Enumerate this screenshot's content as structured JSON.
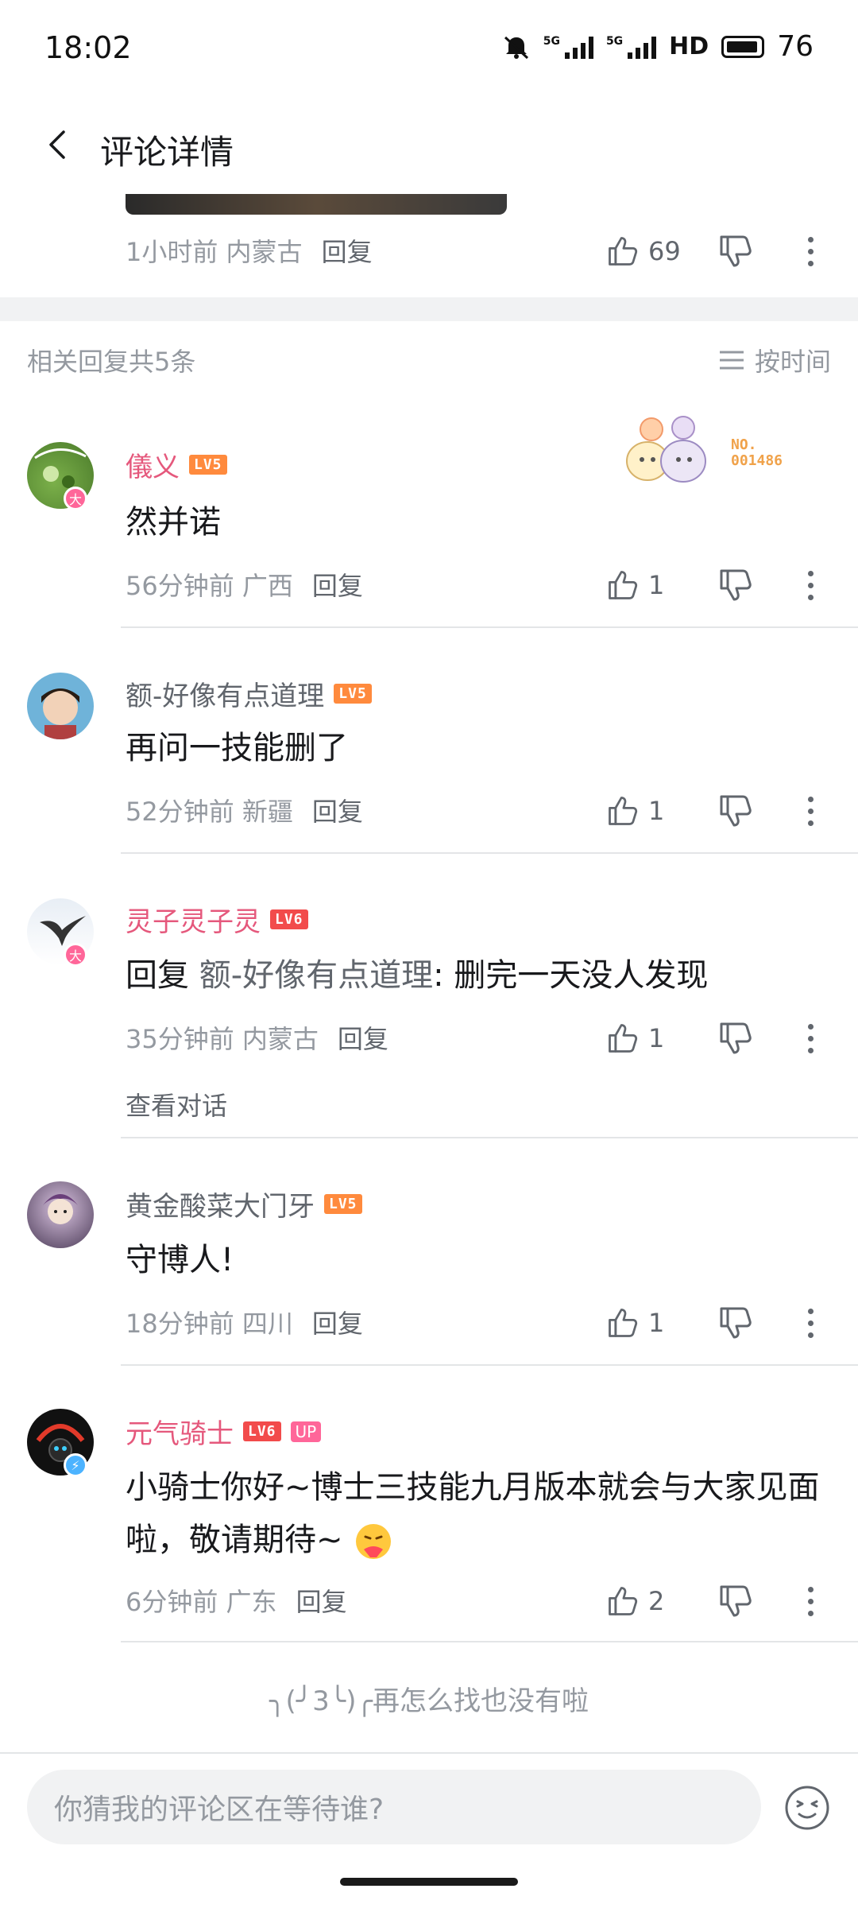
{
  "status": {
    "time": "18:02",
    "sig1": "5G",
    "sig2": "5G",
    "hd": "HD",
    "battery": "76"
  },
  "header": {
    "title": "评论详情"
  },
  "parent": {
    "time": "1小时前",
    "location": "内蒙古",
    "reply": "回复",
    "likes": "69"
  },
  "section": {
    "count_label": "相关回复共5条",
    "sort_label": "按时间"
  },
  "fan_badge": {
    "line1": "NO.",
    "line2": "001486"
  },
  "comments": [
    {
      "user": "儀义",
      "level": "LV5",
      "text": "然并诺",
      "time": "56分钟前",
      "location": "广西",
      "reply": "回复",
      "likes": "1",
      "badge": "大"
    },
    {
      "user": "额-好像有点道理",
      "level": "LV5",
      "text": "再问一技能删了",
      "time": "52分钟前",
      "location": "新疆",
      "reply": "回复",
      "likes": "1"
    },
    {
      "user": "灵子灵子灵",
      "level": "LV6",
      "reply_prefix": "回复",
      "mention": "额-好像有点道理",
      "text": ": 删完一天没人发现",
      "time": "35分钟前",
      "location": "内蒙古",
      "reply": "回复",
      "likes": "1",
      "view_conv": "查看对话",
      "badge": "大"
    },
    {
      "user": "黄金酸菜大门牙",
      "level": "LV5",
      "text": "守博人!",
      "time": "18分钟前",
      "location": "四川",
      "reply": "回复",
      "likes": "1"
    },
    {
      "user": "元气骑士",
      "level": "LV6",
      "up": "UP",
      "text": "小骑士你好~博士三技能九月版本就会与大家见面啦，敬请期待~",
      "time": "6分钟前",
      "location": "广东",
      "reply": "回复",
      "likes": "2"
    }
  ],
  "end_text": "╮(╯3╰)╭再怎么找也没有啦",
  "input": {
    "placeholder": "你猜我的评论区在等待谁?"
  },
  "colors": {
    "pink_name": "#e5587c",
    "lv5": "#ff8a3d",
    "lv6": "#f24b4b",
    "up_badge": "#ff6699"
  }
}
